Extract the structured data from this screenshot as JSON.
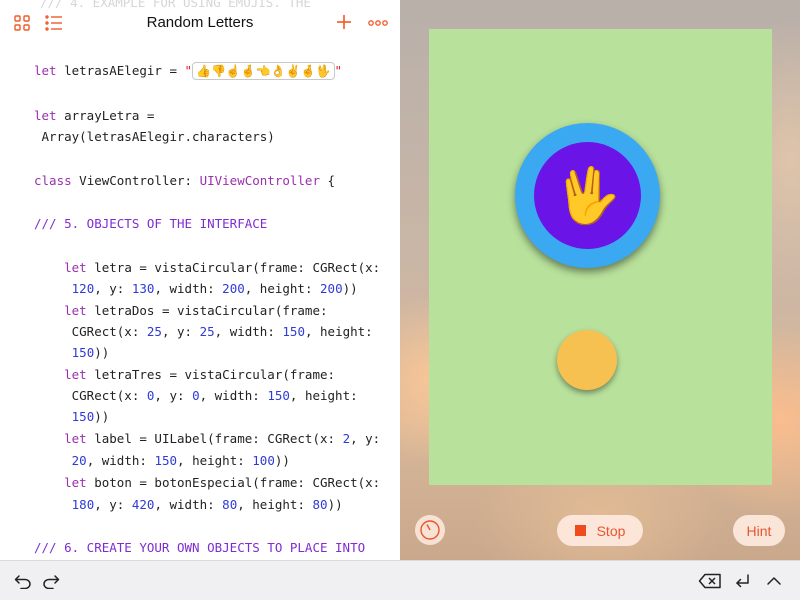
{
  "app": {
    "title": "Random Letters",
    "accent_color": "#f05a28"
  },
  "toolbar": {
    "left_icons": [
      "grid-icon",
      "list-icon"
    ],
    "right_icons": [
      "plus-icon",
      "more-icon"
    ]
  },
  "code": {
    "ghost_text": "/// 4. EXAMPLE FOR USING EMOJIS. THE",
    "lines": [
      {
        "parts": [
          [
            "kw",
            "let"
          ],
          [
            "plain",
            " letrasAElegir = "
          ],
          [
            "str",
            "\""
          ],
          [
            "emoji",
            "👍👎☝️🤞👈👌✌️🤞🖖"
          ],
          [
            "str",
            "\""
          ]
        ]
      },
      {
        "parts": [
          [
            "kw",
            "let"
          ],
          [
            "plain",
            " arrayLetra ="
          ]
        ]
      },
      {
        "parts": [
          [
            "plain",
            " Array(letrasAElegir.characters)"
          ]
        ]
      },
      {
        "parts": [
          [
            "kw",
            "class"
          ],
          [
            "plain",
            " ViewController: "
          ],
          [
            "kw",
            "UIViewController"
          ],
          [
            "plain",
            " {"
          ]
        ]
      },
      {
        "parts": [
          [
            "cm",
            "/// 5. OBJECTS OF THE INTERFACE"
          ]
        ]
      },
      {
        "parts": [
          [
            "plain",
            "    "
          ],
          [
            "kw",
            "let"
          ],
          [
            "plain",
            " letra = vistaCircular(frame: CGRect(x:"
          ]
        ]
      },
      {
        "parts": [
          [
            "plain",
            "     "
          ],
          [
            "num",
            "120"
          ],
          [
            "plain",
            ", y: "
          ],
          [
            "num",
            "130"
          ],
          [
            "plain",
            ", width: "
          ],
          [
            "num",
            "200"
          ],
          [
            "plain",
            ", height: "
          ],
          [
            "num",
            "200"
          ],
          [
            "plain",
            "))"
          ]
        ]
      },
      {
        "parts": [
          [
            "plain",
            "    "
          ],
          [
            "kw",
            "let"
          ],
          [
            "plain",
            " letraDos = vistaCircular(frame:"
          ]
        ]
      },
      {
        "parts": [
          [
            "plain",
            "     CGRect(x: "
          ],
          [
            "num",
            "25"
          ],
          [
            "plain",
            ", y: "
          ],
          [
            "num",
            "25"
          ],
          [
            "plain",
            ", width: "
          ],
          [
            "num",
            "150"
          ],
          [
            "plain",
            ", height:"
          ]
        ]
      },
      {
        "parts": [
          [
            "plain",
            "     "
          ],
          [
            "num",
            "150"
          ],
          [
            "plain",
            "))"
          ]
        ]
      },
      {
        "parts": [
          [
            "plain",
            "    "
          ],
          [
            "kw",
            "let"
          ],
          [
            "plain",
            " letraTres = vistaCircular(frame:"
          ]
        ]
      },
      {
        "parts": [
          [
            "plain",
            "     CGRect(x: "
          ],
          [
            "num",
            "0"
          ],
          [
            "plain",
            ", y: "
          ],
          [
            "num",
            "0"
          ],
          [
            "plain",
            ", width: "
          ],
          [
            "num",
            "150"
          ],
          [
            "plain",
            ", height:"
          ]
        ]
      },
      {
        "parts": [
          [
            "plain",
            "     "
          ],
          [
            "num",
            "150"
          ],
          [
            "plain",
            "))"
          ]
        ]
      },
      {
        "parts": [
          [
            "plain",
            "    "
          ],
          [
            "kw",
            "let"
          ],
          [
            "plain",
            " label = UILabel(frame: CGRect(x: "
          ],
          [
            "num",
            "2"
          ],
          [
            "plain",
            ", y:"
          ]
        ]
      },
      {
        "parts": [
          [
            "plain",
            "     "
          ],
          [
            "num",
            "20"
          ],
          [
            "plain",
            ", width: "
          ],
          [
            "num",
            "150"
          ],
          [
            "plain",
            ", height: "
          ],
          [
            "num",
            "100"
          ],
          [
            "plain",
            "))"
          ]
        ]
      },
      {
        "parts": [
          [
            "plain",
            "    "
          ],
          [
            "kw",
            "let"
          ],
          [
            "plain",
            " boton = botonEspecial(frame: CGRect(x:"
          ]
        ]
      },
      {
        "parts": [
          [
            "plain",
            "     "
          ],
          [
            "num",
            "180"
          ],
          [
            "plain",
            ", y: "
          ],
          [
            "num",
            "420"
          ],
          [
            "plain",
            ", width: "
          ],
          [
            "num",
            "80"
          ],
          [
            "plain",
            ", height: "
          ],
          [
            "num",
            "80"
          ],
          [
            "plain",
            "))"
          ]
        ]
      },
      {
        "parts": [
          [
            "cm",
            "/// 6. CREATE YOUR OWN OBJECTS TO PLACE INTO"
          ]
        ]
      }
    ]
  },
  "live_view": {
    "big_circle_emoji": "🖖",
    "colors": {
      "canvas": "#b8e19b",
      "outer_circle": "#3aa9f2",
      "inner_circle": "#6a14e8",
      "small_circle": "#f7c152"
    }
  },
  "controls": {
    "stop_label": "Stop",
    "hint_label": "Hint",
    "speed_icon": "speedometer-icon"
  },
  "bottom_bar": {
    "left_icons": [
      "undo-icon",
      "redo-icon"
    ],
    "right_icons": [
      "delete-icon",
      "return-icon",
      "chevron-up-icon"
    ]
  }
}
